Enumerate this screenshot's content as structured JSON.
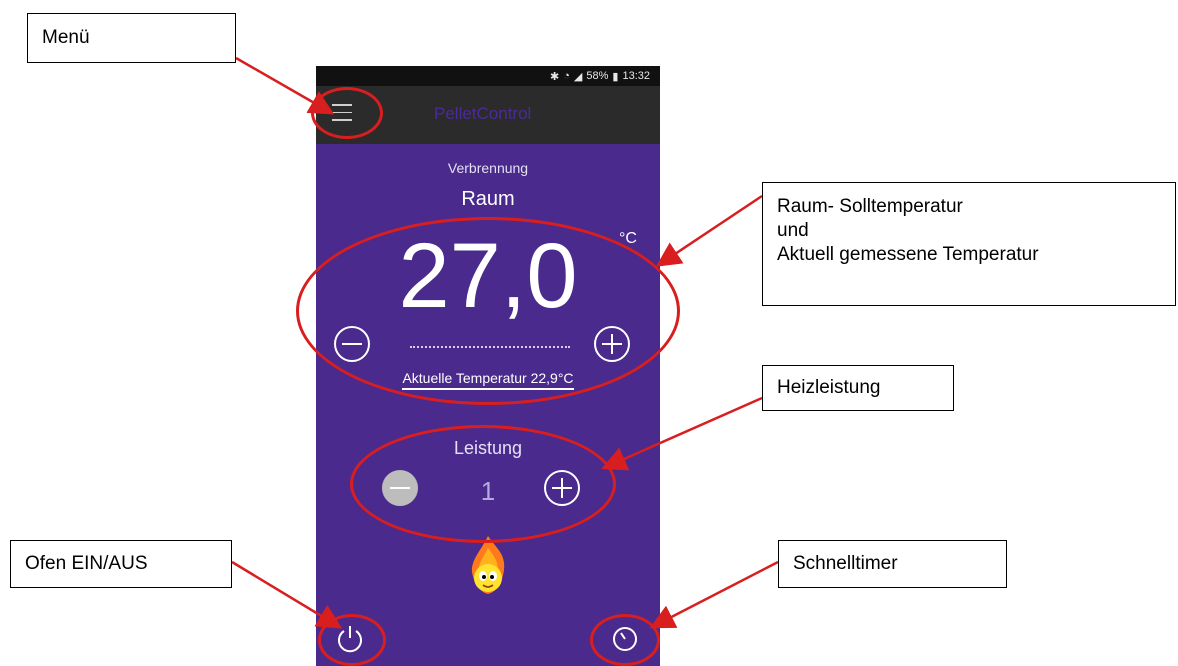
{
  "status_bar": {
    "icons": [
      "bluetooth-icon",
      "wifi-icon",
      "signal-icon"
    ],
    "battery": "58%",
    "time": "13:32"
  },
  "toolbar": {
    "app_title": "PelletControl",
    "menu_icon": "hamburger-icon"
  },
  "main": {
    "mode": "Verbrennung",
    "room_label": "Raum",
    "set_temperature": "27,0",
    "unit": "°C",
    "current_temperature": "Aktuelle Temperatur 22,9°C",
    "power_label": "Leistung",
    "power_value": "1"
  },
  "annotations": {
    "menu": "Menü",
    "temperature": [
      "Raum- Solltemperatur",
      "und",
      "Aktuell gemessene Temperatur"
    ],
    "heating_power": "Heizleistung",
    "oven_on_off": "Ofen EIN/AUS",
    "quick_timer": "Schnelltimer"
  },
  "colors": {
    "background": "#4a2a8c",
    "toolbar": "#2b2b2b",
    "annotation_red": "#d81e1e"
  }
}
